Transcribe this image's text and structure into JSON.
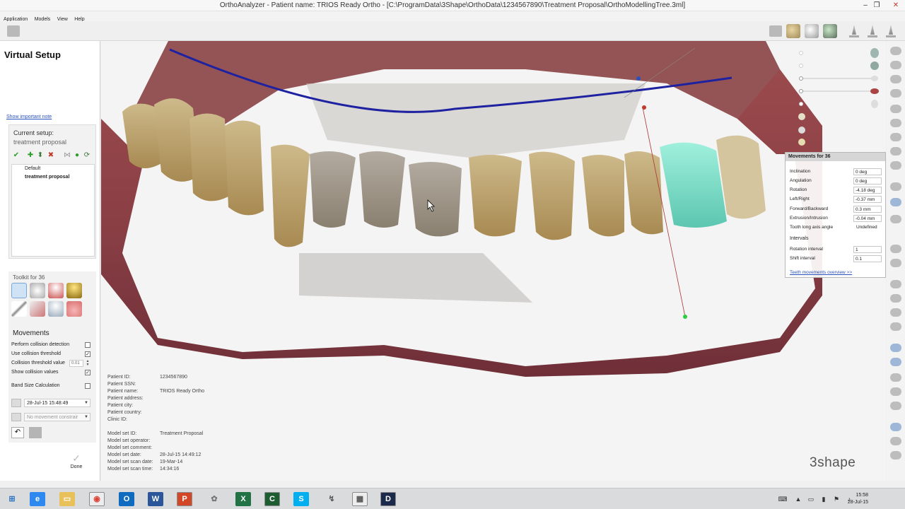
{
  "window": {
    "title": "OrthoAnalyzer - Patient name:  TRIOS Ready Ortho - [C:\\ProgramData\\3Shape\\OrthoData\\1234567890\\Treatment Proposal\\OrthoModellingTree.3ml]"
  },
  "menu": [
    "Application",
    "Models",
    "View",
    "Help"
  ],
  "left_panel": {
    "title": "Virtual Setup",
    "important_note_link": "Show important note",
    "current_setup_label": "Current setup:",
    "current_setup_value": "treatment proposal",
    "setups": [
      "Default",
      "treatment proposal"
    ],
    "toolkit_label": "Toolkit for 36",
    "movements_label": "Movements",
    "movement_options": [
      {
        "label": "Perform collision detection",
        "checked": false
      },
      {
        "label": "Use collision threshold",
        "checked": true
      },
      {
        "label": "Collision threshold value",
        "value": "0.01"
      },
      {
        "label": "Show collision values",
        "checked": true
      },
      {
        "label": "Band Size Calculation",
        "checked": false
      }
    ],
    "date_select": "28-Jul-15  15:48:49",
    "movement_constraint": "No movement constrair",
    "done_label": "Done"
  },
  "patient_info": {
    "labels": [
      "Patient ID:",
      "Patient SSN:",
      "Patient name:",
      "Patient address:",
      "Patient city:",
      "Patient country:",
      "Clinic ID:"
    ],
    "values": [
      "1234567890",
      "",
      "TRIOS Ready Ortho",
      "",
      "",
      "",
      ""
    ]
  },
  "model_info": {
    "labels": [
      "Model set ID:",
      "Model set operator:",
      "Model set comment:",
      "Model set date:",
      "Model set scan date:",
      "Model set scan time:"
    ],
    "values": [
      "Treatment Proposal",
      "",
      "",
      "28-Jul-15 14:49:12",
      "19-Mar-14",
      "14:34:16"
    ]
  },
  "movements_panel": {
    "header": "Movements for 36",
    "rows": [
      {
        "label": "Inclination",
        "value": "0 deg"
      },
      {
        "label": "Angulation",
        "value": "0 deg"
      },
      {
        "label": "Rotation",
        "value": "-4.18 deg"
      },
      {
        "label": "Left/Right",
        "value": "-0.37 mm"
      },
      {
        "label": "Forward/Backward",
        "value": "0.3 mm"
      },
      {
        "label": "Extrusion/Intrusion",
        "value": "-0.04 mm"
      },
      {
        "label": "Tooth long axis angle",
        "value": "Undefined"
      }
    ],
    "intervals_label": "Intervals",
    "intervals": [
      {
        "label": "Rotation interval",
        "value": "1"
      },
      {
        "label": "Shift interval",
        "value": "0.1"
      }
    ],
    "overview_link": "Teeth movements overview >>"
  },
  "logo": "3shape",
  "clock": {
    "time": "15:58",
    "date": "28-Jul-15"
  },
  "colors": {
    "accent": "#2a52be",
    "arch_line": "#1e22a0",
    "highlight_tooth": "#7fe0c8"
  }
}
